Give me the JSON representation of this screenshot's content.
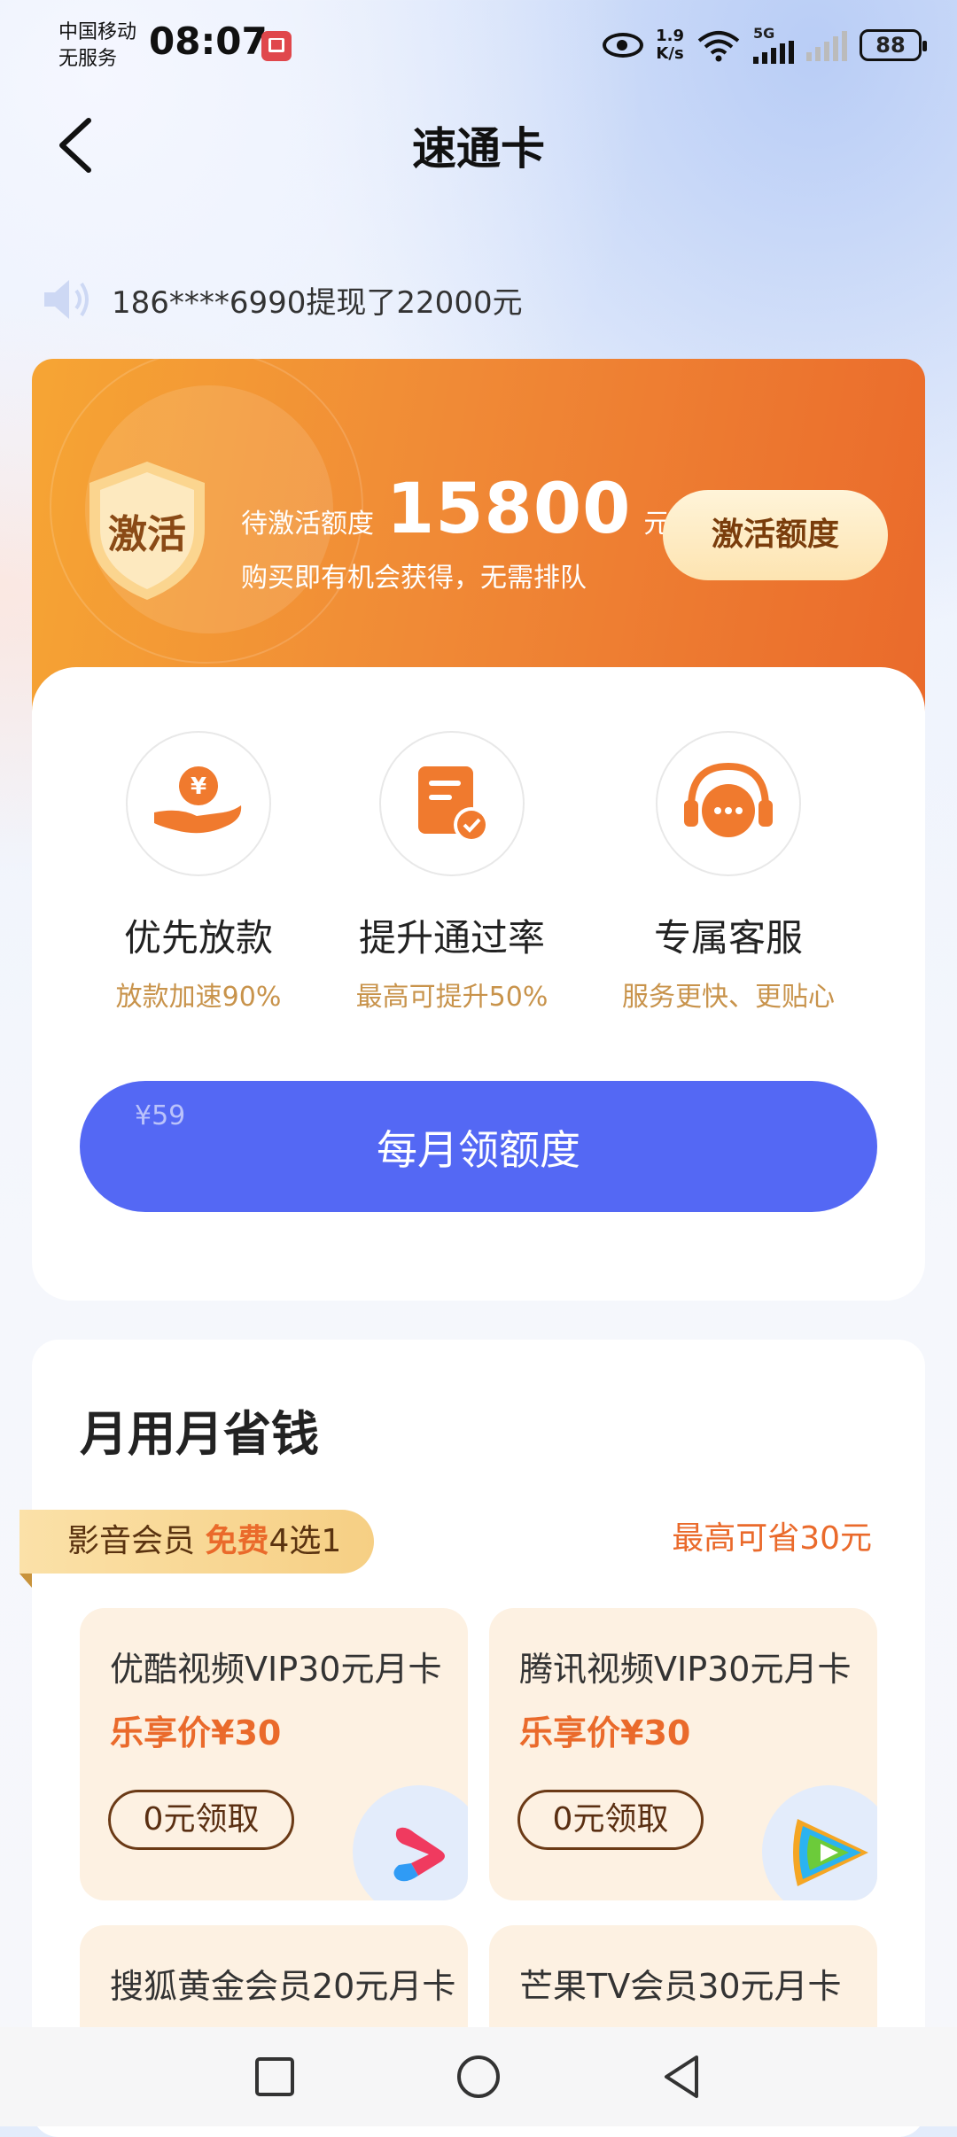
{
  "status_bar": {
    "carrier_line1": "中国移动",
    "carrier_line2": "无服务",
    "time": "08:07",
    "net_speed_value": "1.9",
    "net_speed_unit": "K/s",
    "network_type": "5G",
    "battery": "88"
  },
  "header": {
    "title": "速通卡"
  },
  "ticker": {
    "text": "186****6990提现了22000元"
  },
  "promo": {
    "shield_label": "激活",
    "pending_label": "待激活额度",
    "amount": "15800",
    "unit": "元",
    "subtitle": "购买即有机会获得，无需排队",
    "activate_button": "激活额度"
  },
  "benefits": [
    {
      "title": "优先放款",
      "subtitle": "放款加速90%",
      "icon": "money-hand-icon"
    },
    {
      "title": "提升通过率",
      "subtitle": "最高可提升50%",
      "icon": "document-check-icon"
    },
    {
      "title": "专属客服",
      "subtitle": "服务更快、更贴心",
      "icon": "headset-chat-icon"
    }
  ],
  "monthly_button": {
    "price": "¥59",
    "label": "每月领额度"
  },
  "savings": {
    "title": "月用月省钱",
    "ribbon_prefix": "影音会员 ",
    "ribbon_free": "免费",
    "ribbon_suffix": "4选1",
    "max_save": "最高可省30元",
    "cards": [
      {
        "name": "优酷视频VIP30元月卡",
        "price": "乐享价¥30",
        "claim": "0元领取",
        "logo": "youku-logo-icon"
      },
      {
        "name": "腾讯视频VIP30元月卡",
        "price": "乐享价¥30",
        "claim": "0元领取",
        "logo": "tencent-video-logo-icon"
      },
      {
        "name": "搜狐黄金会员20元月卡"
      },
      {
        "name": "芒果TV会员30元月卡"
      }
    ]
  },
  "colors": {
    "accent_blue": "#5468f4",
    "accent_orange": "#ea6a2b",
    "gold_text": "#c8934b"
  }
}
